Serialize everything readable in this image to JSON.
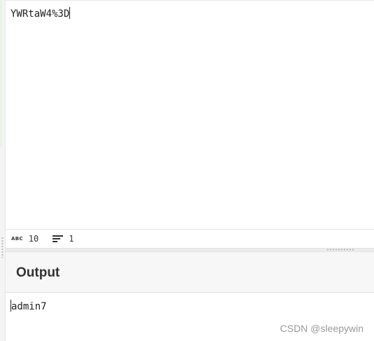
{
  "input": {
    "text": "YWRtaW4%3D"
  },
  "status": {
    "abc_icon": "ABC",
    "char_count": "10",
    "line_count": "1"
  },
  "output": {
    "title": "Output",
    "text": "admin7"
  },
  "watermark": "CSDN @sleepywin",
  "icons": {
    "char_count": "abc-icon",
    "line_count": "lines-icon"
  }
}
